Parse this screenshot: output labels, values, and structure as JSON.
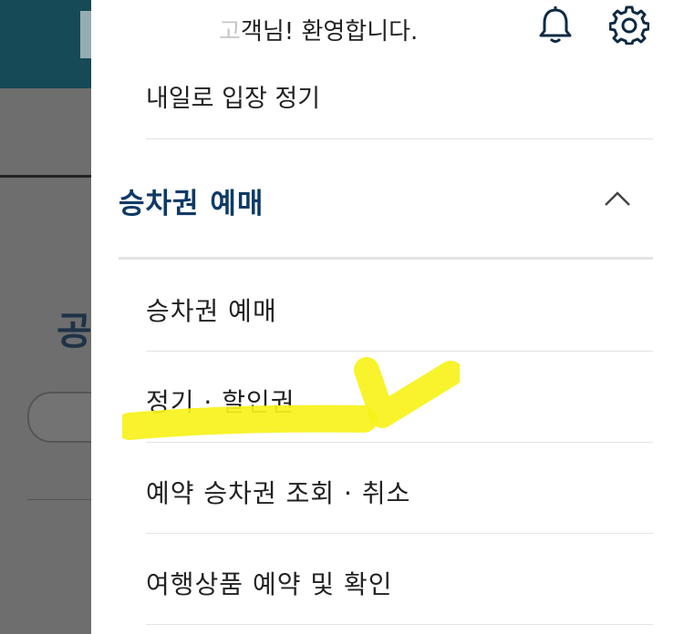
{
  "header": {
    "greeting_faded": "고",
    "greeting": "객님! 환영합니다.",
    "icons": [
      "bell-icon",
      "gear-icon"
    ]
  },
  "drawer": {
    "previous_item_label": "내일로 입장 정기",
    "section": {
      "title": "승차권 예매",
      "expanded": true,
      "items": [
        {
          "label": "승차권 예매"
        },
        {
          "label": "정기 · 할인권"
        },
        {
          "label": "예약 승차권 조회 · 취소"
        },
        {
          "label": "여행상품 예약 및 확인"
        }
      ]
    }
  },
  "background": {
    "title_fragment": "공"
  },
  "colors": {
    "section_title": "#0e3a66",
    "header_bg": "#154a56",
    "overlay_bg": "#6e6e6e",
    "highlight": "#f7f21a"
  }
}
